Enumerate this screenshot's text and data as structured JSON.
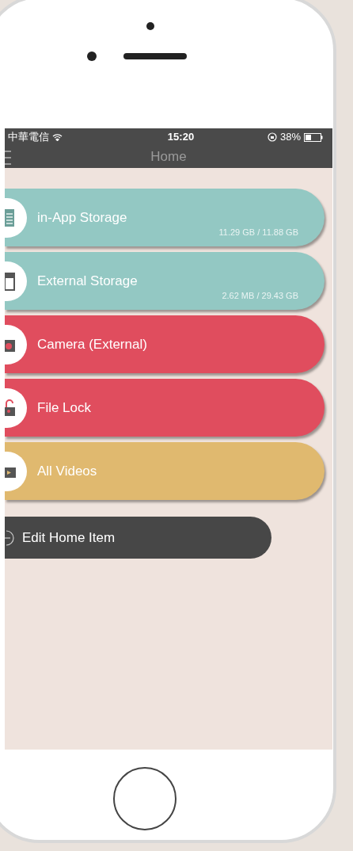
{
  "status_bar": {
    "carrier": "中華電信",
    "time": "15:20",
    "battery": "38%"
  },
  "nav_bar": {
    "title": "Home"
  },
  "items": [
    {
      "kind": "document",
      "label": "in-App Storage",
      "usage": "11.29 GB / 11.88 GB",
      "color": "#93c8c3"
    },
    {
      "kind": "sd-card",
      "label": "External Storage",
      "usage": "2.62 MB / 29.43 GB",
      "color": "#93c8c3"
    },
    {
      "kind": "camera",
      "label": "Camera (External)",
      "color": "#e04d5e"
    },
    {
      "kind": "lock",
      "label": "File Lock",
      "color": "#e04d5e"
    },
    {
      "kind": "video",
      "label": "All Videos",
      "color": "#e0b96f"
    }
  ],
  "edit_button": {
    "label": "Edit Home Item"
  }
}
